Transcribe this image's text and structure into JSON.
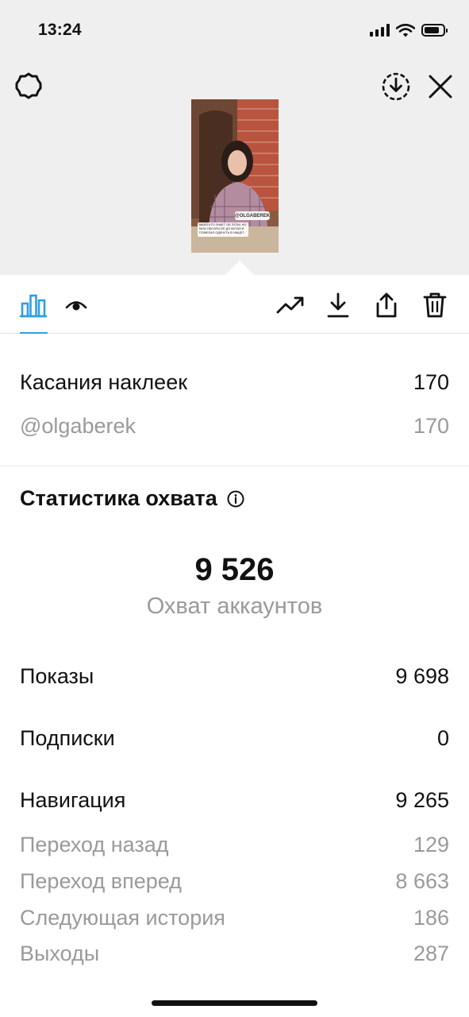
{
  "status_bar": {
    "time": "13:24"
  },
  "story_preview": {
    "mention_sticker": "@OLGABEREK",
    "caption": "МАЛО КТО ЗНАЕТ ОБ ЭТОМ, НО МОИ ОБОЗРЫ ЕЕ ДО КИТАЯ И ПОЖЕЛАЛ ОДЕНУТЬ В НАЩЕТ."
  },
  "stickers": {
    "label": "Касания наклеек",
    "value": "170",
    "items": [
      {
        "label": "@olgaberek",
        "value": "170"
      }
    ]
  },
  "reach": {
    "title": "Статистика охвата",
    "number": "9 526",
    "caption": "Охват аккаунтов"
  },
  "metrics": [
    {
      "label": "Показы",
      "value": "9 698"
    },
    {
      "label": "Подписки",
      "value": "0"
    },
    {
      "label": "Навигация",
      "value": "9 265"
    }
  ],
  "navigation_details": [
    {
      "label": "Переход назад",
      "value": "129"
    },
    {
      "label": "Переход вперед",
      "value": "8 663"
    },
    {
      "label": "Следующая история",
      "value": "186"
    },
    {
      "label": "Выходы",
      "value": "287"
    }
  ],
  "colors": {
    "accent": "#2f9ee6",
    "muted": "#9a9a9a",
    "header_bg": "#efefef"
  }
}
